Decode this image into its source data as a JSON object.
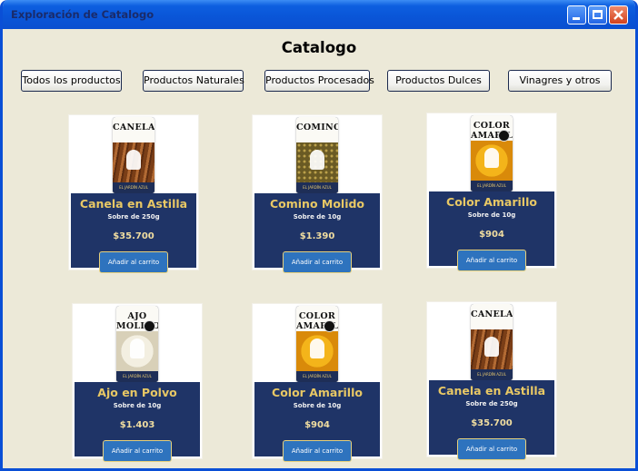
{
  "window": {
    "title": "Exploración de Catalogo"
  },
  "page_title": "Catalogo",
  "category_buttons": [
    "Todos los productos",
    "Productos Naturales",
    "Productos Procesados",
    "Productos Dulces",
    "Vinagres y otros"
  ],
  "products": [
    {
      "name": "Canela en Astilla",
      "size": "Sobre de 250g",
      "price": "$35.700",
      "add_label": "Añadir al carrito",
      "package_label": "CANELA",
      "package_contents": "cinnamon"
    },
    {
      "name": "Comino Molido",
      "size": "Sobre de 10g",
      "price": "$1.390",
      "add_label": "Añadir al carrito",
      "package_label": "COMINO",
      "package_contents": "cumin"
    },
    {
      "name": "Color Amarillo",
      "size": "Sobre de 10g",
      "price": "$904",
      "add_label": "Añadir al carrito",
      "package_label": "COLOR AMARILLO",
      "package_contents": "yellow"
    },
    {
      "name": "Ajo en Polvo",
      "size": "Sobre de 10g",
      "price": "$1.403",
      "add_label": "Añadir al carrito",
      "package_label": "AJO MOLIDO",
      "package_contents": "garlic"
    },
    {
      "name": "Color Amarillo",
      "size": "Sobre de 10g",
      "price": "$904",
      "add_label": "Añadir al carrito",
      "package_label": "COLOR AMARILLO",
      "package_contents": "yellow"
    },
    {
      "name": "Canela en Astilla",
      "size": "Sobre de 250g",
      "price": "$35.700",
      "add_label": "Añadir al carrito",
      "package_label": "CANELA",
      "package_contents": "cinnamon"
    }
  ],
  "package_footer": "EL JARDÍN AZUL",
  "colors": {
    "card_panel": "#1f3467",
    "product_name": "#e8c865",
    "add_button": "#2e73be",
    "window_bg": "#ece9d8"
  }
}
